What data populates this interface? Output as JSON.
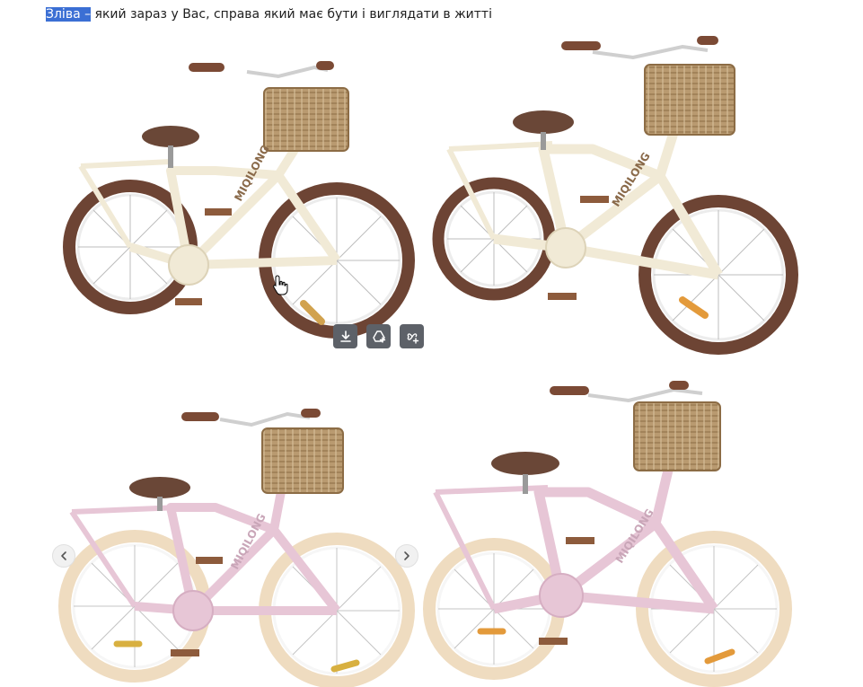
{
  "caption": {
    "highlight": "Зліва –",
    "rest": " який зараз у Вас, справа який має бути і виглядати в житті"
  },
  "brand_text": "MIQILONG",
  "colors": {
    "selection": "#3b6fd4",
    "cream_frame": "#f1ead6",
    "pink_frame": "#e7c6d6",
    "brown_tire": "#6d4434",
    "cream_tire": "#efdcc0",
    "basket": "#b6976e",
    "saddle": "#6a4737",
    "toolbar_button": "#5d6168"
  },
  "images": [
    {
      "name": "bike-cream-current"
    },
    {
      "name": "bike-cream-real"
    },
    {
      "name": "bike-pink-current"
    },
    {
      "name": "bike-pink-real"
    }
  ],
  "toolbar": {
    "icons": [
      "download-icon",
      "add-to-drive-icon",
      "pin-add-icon"
    ]
  },
  "navigation": {
    "prev_icon": "chevron-left-icon",
    "next_icon": "chevron-right-icon"
  }
}
